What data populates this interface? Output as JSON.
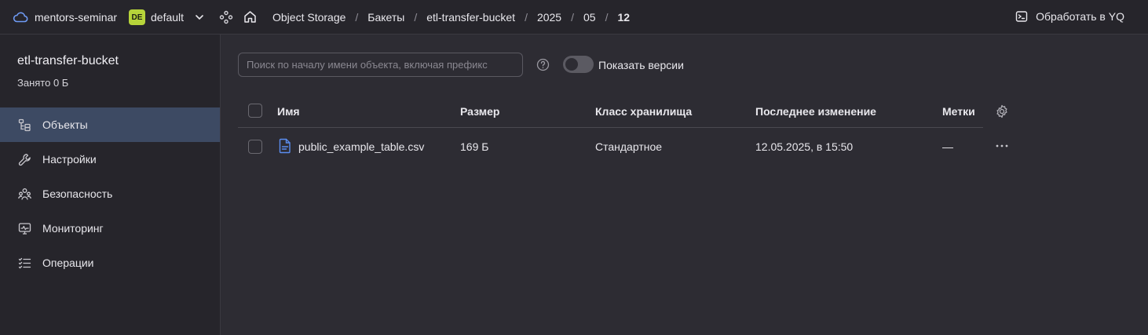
{
  "topbar": {
    "org": "mentors-seminar",
    "folder_badge": "DE",
    "folder": "default",
    "breadcrumbs": [
      "Object Storage",
      "Бакеты",
      "etl-transfer-bucket",
      "2025",
      "05",
      "12"
    ],
    "yq_button": "Обработать в YQ",
    "icons": [
      "cloud-icon",
      "chevron-down-icon",
      "services-icon",
      "home-icon",
      "terminal-icon"
    ]
  },
  "sidebar": {
    "bucket_name": "etl-transfer-bucket",
    "usage": "Занято 0 Б",
    "items": [
      {
        "label": "Объекты",
        "icon": "objects-icon",
        "active": true
      },
      {
        "label": "Настройки",
        "icon": "wrench-icon",
        "active": false
      },
      {
        "label": "Безопасность",
        "icon": "users-icon",
        "active": false
      },
      {
        "label": "Мониторинг",
        "icon": "monitor-icon",
        "active": false
      },
      {
        "label": "Операции",
        "icon": "list-icon",
        "active": false
      }
    ]
  },
  "main": {
    "search_placeholder": "Поиск по началу имени объекта, включая префикс",
    "show_versions": "Показать версии",
    "table": {
      "columns": [
        "Имя",
        "Размер",
        "Класс хранилища",
        "Последнее изменение",
        "Метки"
      ],
      "rows": [
        {
          "name": "public_example_table.csv",
          "size": "169 Б",
          "storage_class": "Стандартное",
          "modified": "12.05.2025, в 15:50",
          "tags": "—"
        }
      ]
    }
  },
  "colors": {
    "background": "#2d2c33",
    "panel": "#26252b",
    "active_nav": "#3d4a63",
    "badge": "#b7d43a",
    "file_icon": "#5b8def"
  }
}
